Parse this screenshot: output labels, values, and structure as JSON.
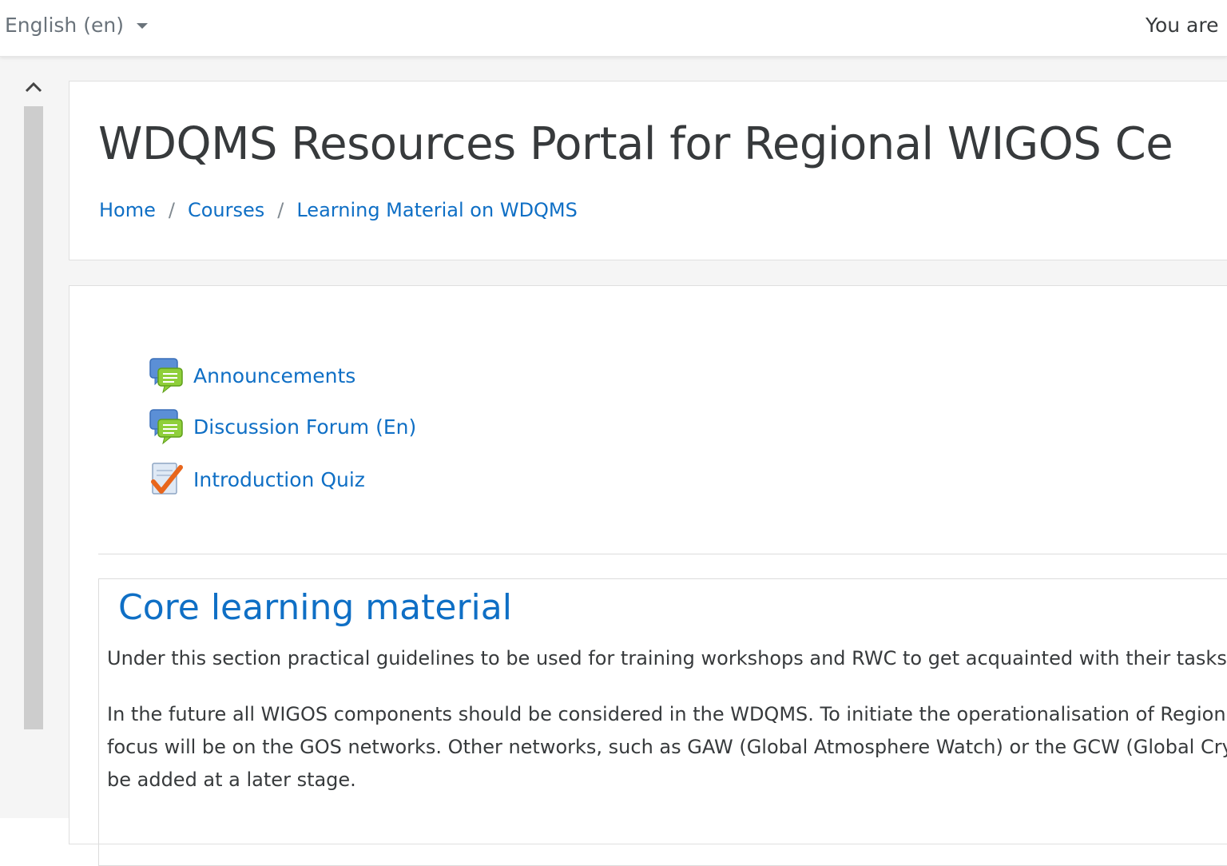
{
  "topbar": {
    "language": "English (en)",
    "user_info": "You are …"
  },
  "header": {
    "title": "WDQMS Resources Portal for Regional WIGOS Ce",
    "breadcrumb": [
      "Home",
      "Courses",
      "Learning Material on WDQMS"
    ]
  },
  "activities": [
    {
      "label": "Announcements",
      "icon": "forum-icon"
    },
    {
      "label": "Discussion Forum (En)",
      "icon": "forum-icon"
    },
    {
      "label": "Introduction Quiz",
      "icon": "quiz-icon"
    }
  ],
  "section": {
    "title": "Core learning material",
    "paragraph1": "Under this section practical guidelines to be used for training workshops and RWC to get acquainted with their tasks a",
    "paragraph2_line1": "In the future all WIGOS components should be considered in the WDQMS. To initiate the operationalisation of Region",
    "paragraph2_line2": "focus will be on the GOS networks. Other networks, such as GAW (Global Atmosphere Watch) or the GCW (Global Cryo",
    "paragraph2_line3": "be added at a later stage."
  },
  "colors": {
    "link": "#0f6fc5",
    "text": "#373a3c",
    "muted": "#6a737b",
    "background": "#f5f5f5"
  }
}
